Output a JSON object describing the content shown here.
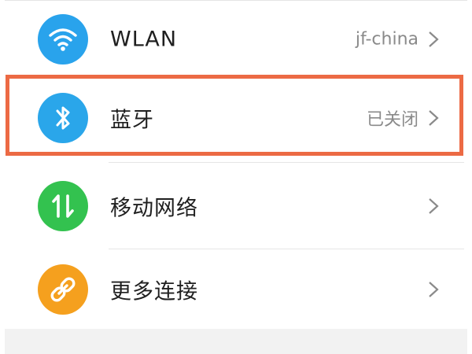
{
  "settings": {
    "items": [
      {
        "label": "WLAN",
        "value": "jf-china",
        "icon": "wifi-icon",
        "color": "#29a3ec"
      },
      {
        "label": "蓝牙",
        "value": "已关闭",
        "icon": "bluetooth-icon",
        "color": "#2aa6ea"
      },
      {
        "label": "移动网络",
        "value": "",
        "icon": "mobile-data-icon",
        "color": "#33c24f"
      },
      {
        "label": "更多连接",
        "value": "",
        "icon": "link-icon",
        "color": "#f5a01e"
      }
    ]
  },
  "highlight": {
    "color": "#ec6a44",
    "target": "bluetooth-row"
  }
}
